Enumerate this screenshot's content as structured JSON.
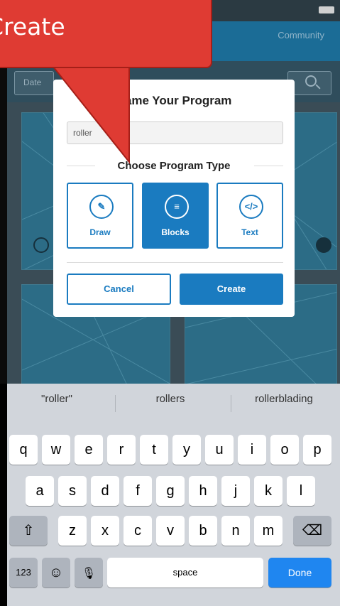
{
  "app": {
    "community_tab": "Community",
    "date_filter": "Date"
  },
  "modal": {
    "title": "Name Your Program",
    "program_name_value": "roller",
    "type_heading": "Choose Program Type",
    "types": [
      {
        "label": "Draw",
        "icon": "draw-icon",
        "selected": false
      },
      {
        "label": "Blocks",
        "icon": "blocks-icon",
        "selected": true
      },
      {
        "label": "Text",
        "icon": "code-icon",
        "selected": false
      }
    ],
    "cancel_label": "Cancel",
    "create_label": "Create"
  },
  "callout": {
    "text": "Create",
    "color": "#df3b33"
  },
  "keyboard": {
    "suggestions": [
      "\"roller\"",
      "rollers",
      "rollerblading"
    ],
    "row1": [
      "q",
      "w",
      "e",
      "r",
      "t",
      "y",
      "u",
      "i",
      "o",
      "p"
    ],
    "row2": [
      "a",
      "s",
      "d",
      "f",
      "g",
      "h",
      "j",
      "k",
      "l"
    ],
    "row3": [
      "z",
      "x",
      "c",
      "v",
      "b",
      "n",
      "m"
    ],
    "numbers_key": "123",
    "space_key": "space",
    "done_key": "Done"
  },
  "colors": {
    "accent": "#1a7bc0",
    "done_key": "#1f86f0"
  }
}
